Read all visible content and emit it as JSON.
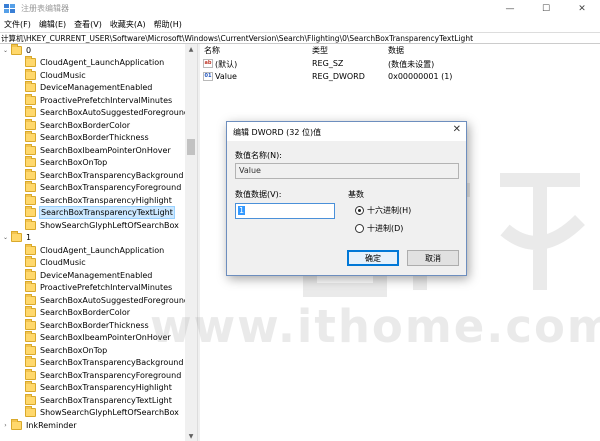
{
  "window": {
    "title": "注册表编辑器",
    "min_glyph": "—",
    "max_glyph": "☐",
    "close_glyph": "✕"
  },
  "menu": [
    "文件(F)",
    "编辑(E)",
    "查看(V)",
    "收藏夹(A)",
    "帮助(H)"
  ],
  "address": "计算机\\HKEY_CURRENT_USER\\Software\\Microsoft\\Windows\\CurrentVersion\\Search\\Flighting\\0\\SearchBoxTransparencyTextLight",
  "tree": {
    "root0": "0",
    "group0": [
      "CloudAgent_LaunchApplication",
      "CloudMusic",
      "DeviceManagementEnabled",
      "ProactivePrefetchIntervalMinutes",
      "SearchBoxAutoSuggestedForegroundCo",
      "SearchBoxBorderColor",
      "SearchBoxBorderThickness",
      "SearchBoxIbeamPointerOnHover",
      "SearchBoxOnTop",
      "SearchBoxTransparencyBackground",
      "SearchBoxTransparencyForeground",
      "SearchBoxTransparencyHighlight",
      "SearchBoxTransparencyTextLight",
      "ShowSearchGlyphLeftOfSearchBox"
    ],
    "selected_index": 12,
    "root1": "1",
    "group1": [
      "CloudAgent_LaunchApplication",
      "CloudMusic",
      "DeviceManagementEnabled",
      "ProactivePrefetchIntervalMinutes",
      "SearchBoxAutoSuggestedForegroundCo",
      "SearchBoxBorderColor",
      "SearchBoxBorderThickness",
      "SearchBoxIbeamPointerOnHover",
      "SearchBoxOnTop",
      "SearchBoxTransparencyBackground",
      "SearchBoxTransparencyForeground",
      "SearchBoxTransparencyHighlight",
      "SearchBoxTransparencyTextLight",
      "ShowSearchGlyphLeftOfSearchBox"
    ],
    "last": "InkReminder"
  },
  "list": {
    "headers": {
      "name": "名称",
      "type": "类型",
      "data": "数据"
    },
    "rows": [
      {
        "icon": "ab",
        "name": "(默认)",
        "type": "REG_SZ",
        "data": "(数值未设置)"
      },
      {
        "icon": "01",
        "name": "Value",
        "type": "REG_DWORD",
        "data": "0x00000001 (1)"
      }
    ]
  },
  "dialog": {
    "title": "编辑 DWORD (32 位)值",
    "close_glyph": "✕",
    "name_label": "数值名称(N):",
    "name_value": "Value",
    "data_label": "数值数据(V):",
    "data_value": "1",
    "base_label": "基数",
    "radio_hex": "十六进制(H)",
    "radio_dec": "十进制(D)",
    "ok": "确定",
    "cancel": "取消"
  },
  "watermark": {
    "text": "www.ithome.com"
  },
  "colors": {
    "selection": "#cce8ff",
    "accent": "#0078d7",
    "folder": "#ffd86c"
  }
}
